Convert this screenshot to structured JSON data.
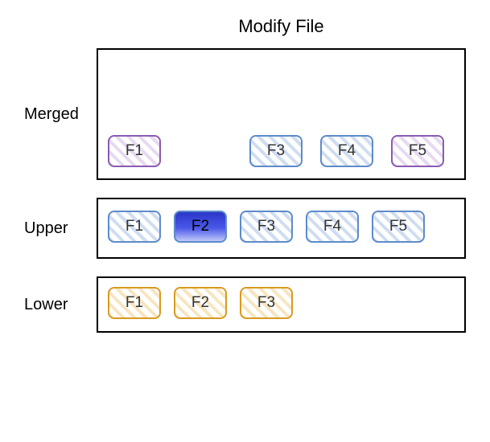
{
  "title": "Modify File",
  "rows": {
    "merged": {
      "label": "Merged",
      "items": [
        {
          "label": "F1",
          "style": "purple"
        },
        null,
        {
          "label": "F3",
          "style": "blue"
        },
        {
          "label": "F4",
          "style": "blue"
        },
        {
          "label": "F5",
          "style": "purple"
        }
      ]
    },
    "upper": {
      "label": "Upper",
      "items": [
        {
          "label": "F1",
          "style": "blue"
        },
        {
          "label": "F2",
          "style": "solid-blue"
        },
        {
          "label": "F3",
          "style": "blue"
        },
        {
          "label": "F4",
          "style": "blue"
        },
        {
          "label": "F5",
          "style": "blue"
        }
      ]
    },
    "lower": {
      "label": "Lower",
      "items": [
        {
          "label": "F1",
          "style": "gold"
        },
        {
          "label": "F2",
          "style": "gold"
        },
        {
          "label": "F3",
          "style": "gold"
        }
      ]
    }
  }
}
